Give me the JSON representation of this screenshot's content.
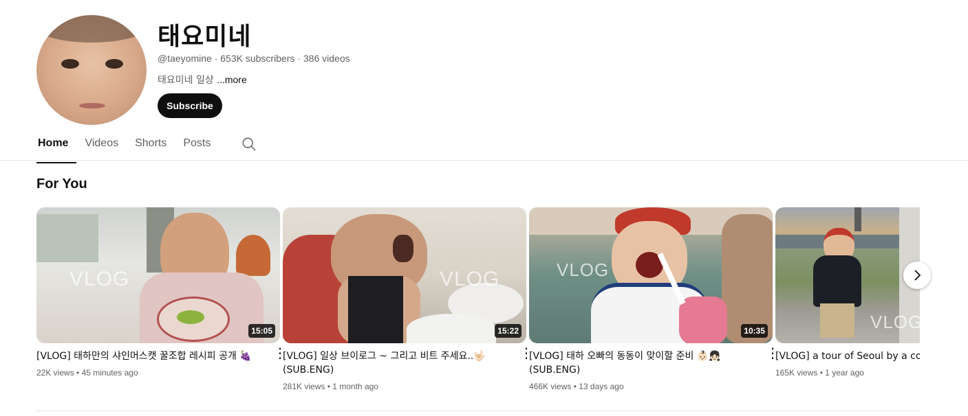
{
  "channel": {
    "name": "태요미네",
    "handle": "@taeyomine",
    "subscribers": "653K subscribers",
    "videos": "386 videos",
    "description": "태요미네 일상 ",
    "more": "...more",
    "subscribe_label": "Subscribe"
  },
  "tabs": [
    {
      "label": "Home",
      "active": true
    },
    {
      "label": "Videos"
    },
    {
      "label": "Shorts"
    },
    {
      "label": "Posts"
    }
  ],
  "section": {
    "title": "For You"
  },
  "videos": [
    {
      "title": "[VLOG] 태하만의 샤인머스캣 꿀조합 레시피 공개 🍇",
      "views": "22K views",
      "age": "45 minutes ago",
      "duration": "15:05",
      "watermark": "VLOG"
    },
    {
      "title": "[VLOG] 일상 브이로그 ~ 그리고 비트 주세요..🤟🏻 (SUB.ENG)",
      "views": "281K views",
      "age": "1 month ago",
      "duration": "15:22",
      "watermark": "VLOG"
    },
    {
      "title": "[VLOG] 태하 오빠의 동동이 맞이할 준비 👶🏻👧🏻 (SUB.ENG)",
      "views": "466K views",
      "age": "13 days ago",
      "duration": "10:35",
      "watermark": "VLOG"
    },
    {
      "title": "[VLOG] a tour of Seoul by a country",
      "views": "165K views",
      "age": "1 year ago",
      "watermark": "VLOG"
    }
  ],
  "meta_separator": " • ",
  "header_separator": " · ",
  "icons": {
    "search": "search-icon",
    "more": "more-vert-icon",
    "next": "chevron-right-icon"
  }
}
